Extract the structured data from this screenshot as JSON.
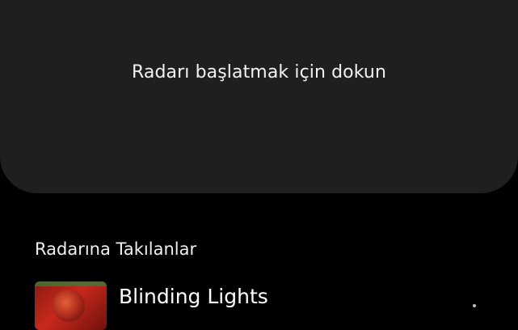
{
  "radar": {
    "prompt": "Radarı başlatmak için dokun"
  },
  "history": {
    "title": "Radarına Takılanlar",
    "tracks": [
      {
        "title": "Blinding Lights"
      }
    ]
  },
  "colors": {
    "background": "#000000",
    "panel": "#1f1f1f",
    "text": "#ffffff"
  }
}
